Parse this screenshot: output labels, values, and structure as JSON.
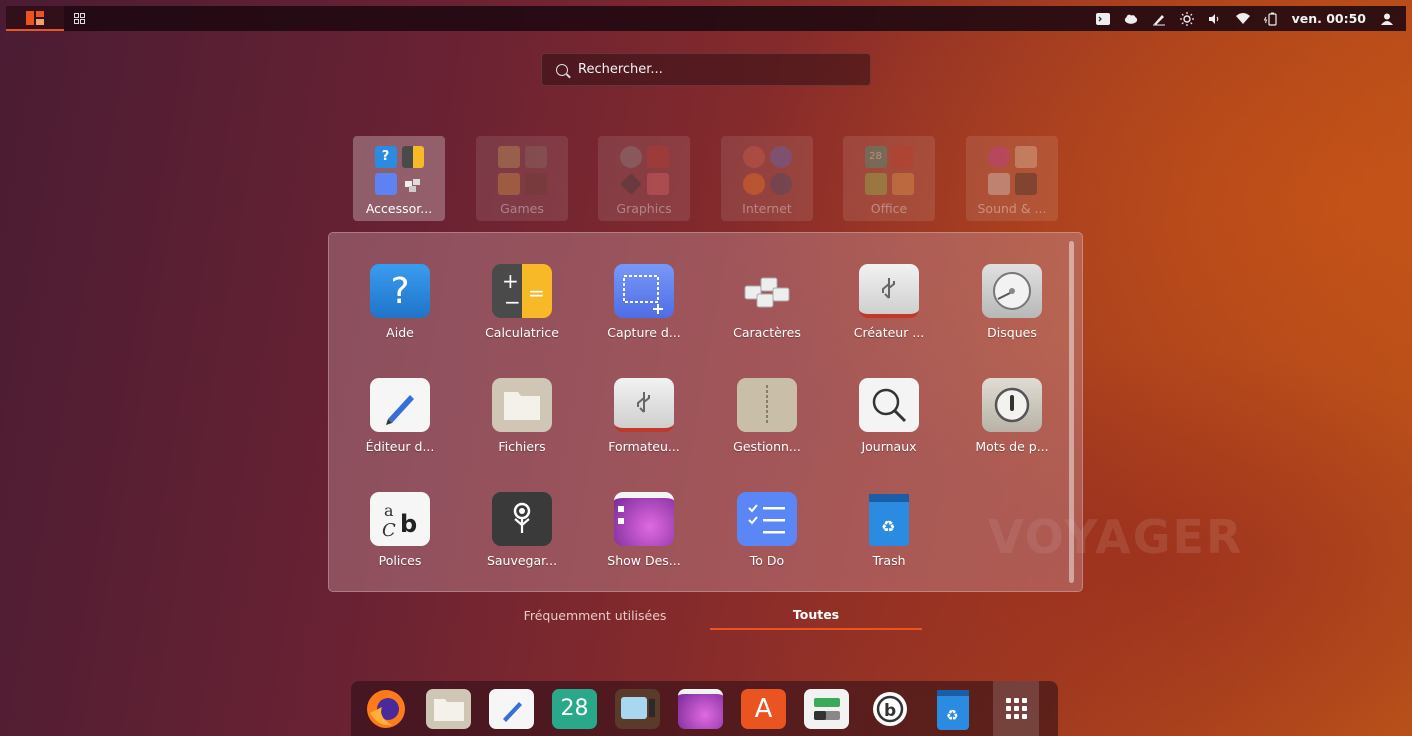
{
  "topbar": {
    "clock": "ven. 00:50",
    "icons": [
      "activities-icon",
      "app-grid-icon",
      "terminal-icon",
      "cloud-icon",
      "pen-icon",
      "brightness-icon",
      "volume-icon",
      "wifi-icon",
      "battery-icon",
      "user-icon"
    ]
  },
  "search": {
    "placeholder": "Rechercher..."
  },
  "folders": [
    {
      "label": "Accessor...",
      "active": true
    },
    {
      "label": "Games"
    },
    {
      "label": "Graphics"
    },
    {
      "label": "Internet"
    },
    {
      "label": "Office"
    },
    {
      "label": "Sound & ..."
    }
  ],
  "apps": [
    {
      "label": "Aide",
      "icon": "help-icon"
    },
    {
      "label": "Calculatrice",
      "icon": "calculator-icon"
    },
    {
      "label": "Capture d...",
      "icon": "screenshot-icon"
    },
    {
      "label": "Caractères",
      "icon": "characters-icon"
    },
    {
      "label": "Créateur ...",
      "icon": "usb-creator-icon"
    },
    {
      "label": "Disques",
      "icon": "disks-icon"
    },
    {
      "label": "Éditeur d...",
      "icon": "text-editor-icon"
    },
    {
      "label": "Fichiers",
      "icon": "files-icon"
    },
    {
      "label": "Formateu...",
      "icon": "usb-formatter-icon"
    },
    {
      "label": "Gestionn...",
      "icon": "archive-manager-icon"
    },
    {
      "label": "Journaux",
      "icon": "logs-icon"
    },
    {
      "label": "Mots de p...",
      "icon": "passwords-icon"
    },
    {
      "label": "Polices",
      "icon": "fonts-icon"
    },
    {
      "label": "Sauvegar...",
      "icon": "backup-icon"
    },
    {
      "label": "Show Des...",
      "icon": "show-desktop-icon"
    },
    {
      "label": "To Do",
      "icon": "todo-icon"
    },
    {
      "label": "Trash",
      "icon": "trash-icon"
    }
  ],
  "tabs": {
    "frequent": "Fréquemment utilisées",
    "all": "Toutes"
  },
  "dock": {
    "calendar_day": "28",
    "items": [
      "firefox-icon",
      "files-icon",
      "text-editor-icon",
      "calendar-icon",
      "tv-icon",
      "show-desktop-icon",
      "software-icon",
      "tweaks-icon",
      "budgie-icon",
      "trash-icon",
      "show-apps-icon"
    ]
  },
  "colors": {
    "accent": "#e95420"
  }
}
